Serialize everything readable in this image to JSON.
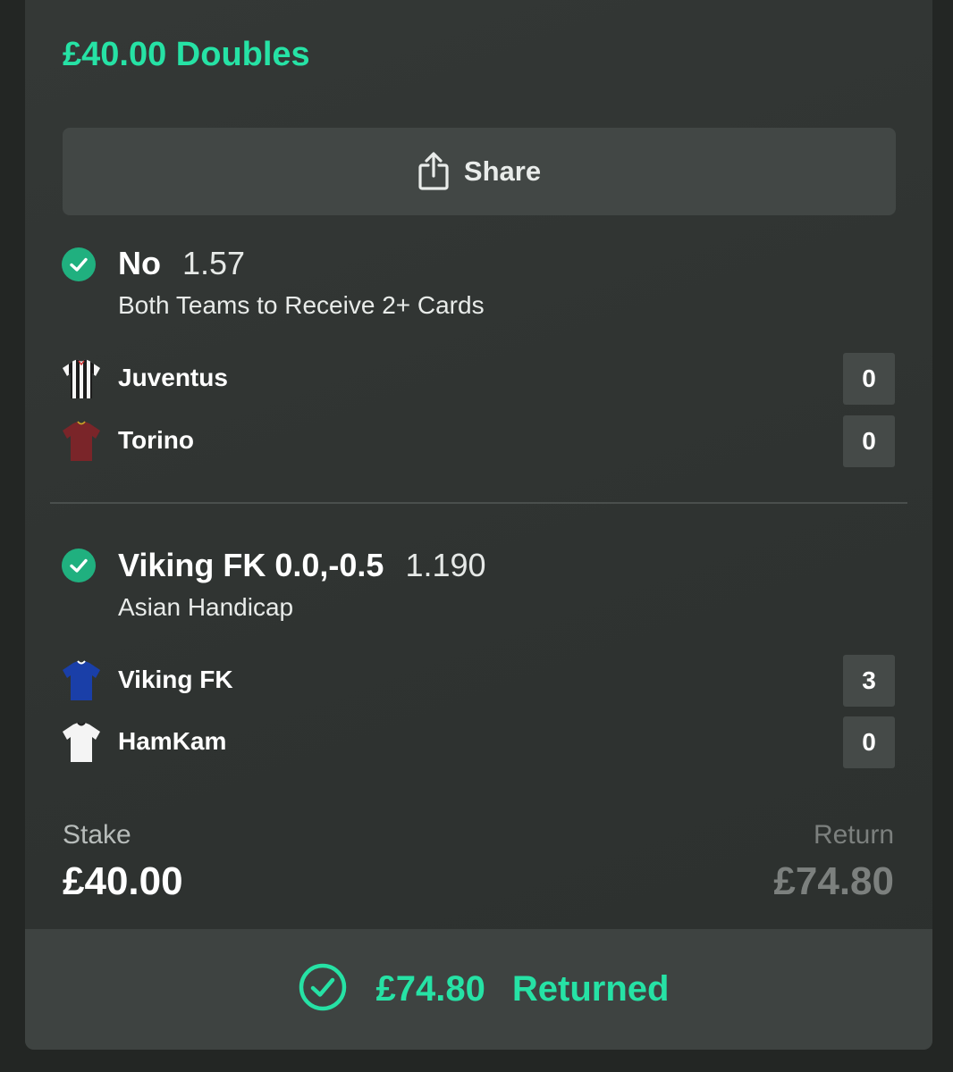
{
  "bet": {
    "title": "£40.00 Doubles",
    "share_label": "Share"
  },
  "legs": [
    {
      "selection": "No",
      "odds": "1.57",
      "market": "Both Teams to Receive 2+ Cards",
      "teams": [
        {
          "name": "Juventus",
          "score": "0",
          "shirt": "striped black and white shirt"
        },
        {
          "name": "Torino",
          "score": "0",
          "shirt": "maroon shirt"
        }
      ]
    },
    {
      "selection": "Viking FK 0.0,-0.5",
      "odds": "1.190",
      "market": "Asian Handicap",
      "teams": [
        {
          "name": "Viking FK",
          "score": "3",
          "shirt": "blue shirt"
        },
        {
          "name": "HamKam",
          "score": "0",
          "shirt": "white shirt"
        }
      ]
    }
  ],
  "summary": {
    "stake_label": "Stake",
    "stake_value": "£40.00",
    "return_label": "Return",
    "return_value": "£74.80"
  },
  "result": {
    "amount": "£74.80",
    "status": "Returned"
  },
  "colors": {
    "accent": "#26e2a5",
    "check": "#20b07f",
    "background": "#232624",
    "card": "#343836"
  }
}
